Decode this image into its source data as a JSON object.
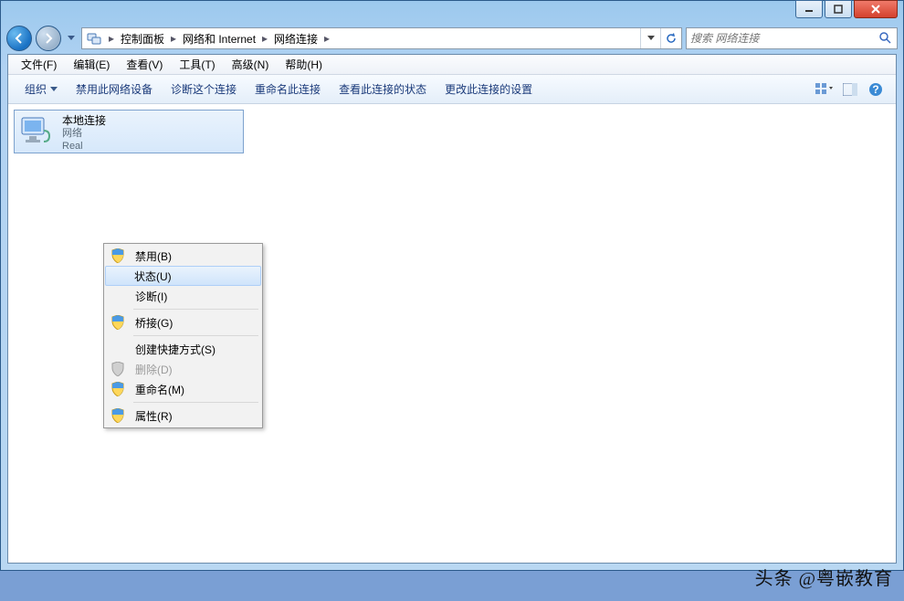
{
  "breadcrumb": {
    "items": [
      "控制面板",
      "网络和 Internet",
      "网络连接"
    ]
  },
  "search": {
    "placeholder": "搜索 网络连接"
  },
  "menubar": {
    "items": [
      "文件(F)",
      "编辑(E)",
      "查看(V)",
      "工具(T)",
      "高级(N)",
      "帮助(H)"
    ]
  },
  "toolbar": {
    "organize": "组织",
    "items": [
      "禁用此网络设备",
      "诊断这个连接",
      "重命名此连接",
      "查看此连接的状态",
      "更改此连接的设置"
    ]
  },
  "connection": {
    "name": "本地连接",
    "status": "网络",
    "device": "Real"
  },
  "context_menu": {
    "items": [
      {
        "label": "禁用(B)",
        "shield": true
      },
      {
        "label": "状态(U)",
        "hover": true
      },
      {
        "label": "诊断(I)"
      },
      {
        "sep": true
      },
      {
        "label": "桥接(G)",
        "shield": true
      },
      {
        "sep": true
      },
      {
        "label": "创建快捷方式(S)"
      },
      {
        "label": "删除(D)",
        "shield": true,
        "disabled": true
      },
      {
        "label": "重命名(M)",
        "shield": true
      },
      {
        "sep": true
      },
      {
        "label": "属性(R)",
        "shield": true
      }
    ]
  },
  "watermark": "头条 @粤嵌教育"
}
